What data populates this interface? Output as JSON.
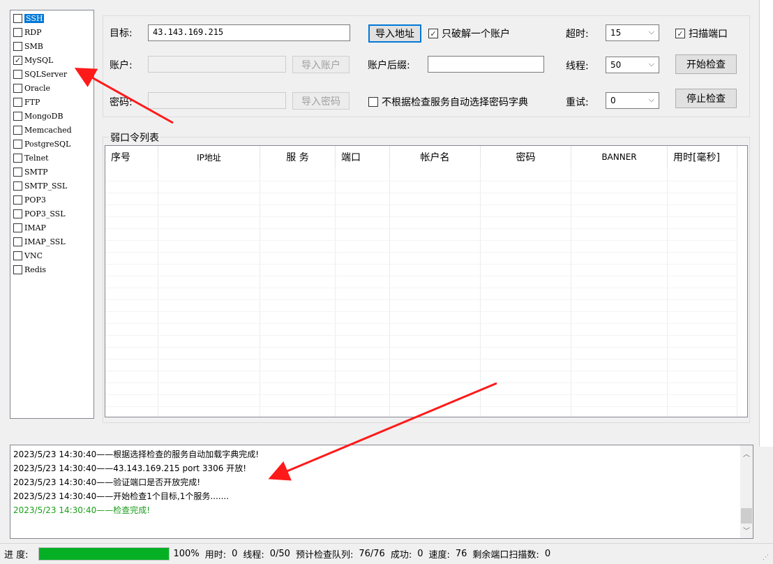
{
  "services": [
    {
      "name": "SSH",
      "checked": false,
      "selected": true
    },
    {
      "name": "RDP",
      "checked": false
    },
    {
      "name": "SMB",
      "checked": false
    },
    {
      "name": "MySQL",
      "checked": true
    },
    {
      "name": "SQLServer",
      "checked": false
    },
    {
      "name": "Oracle",
      "checked": false
    },
    {
      "name": "FTP",
      "checked": false
    },
    {
      "name": "MongoDB",
      "checked": false
    },
    {
      "name": "Memcached",
      "checked": false
    },
    {
      "name": "PostgreSQL",
      "checked": false
    },
    {
      "name": "Telnet",
      "checked": false
    },
    {
      "name": "SMTP",
      "checked": false
    },
    {
      "name": "SMTP_SSL",
      "checked": false
    },
    {
      "name": "POP3",
      "checked": false
    },
    {
      "name": "POP3_SSL",
      "checked": false
    },
    {
      "name": "IMAP",
      "checked": false
    },
    {
      "name": "IMAP_SSL",
      "checked": false
    },
    {
      "name": "VNC",
      "checked": false
    },
    {
      "name": "Redis",
      "checked": false
    }
  ],
  "form": {
    "target_label": "目标:",
    "target_value": "43.143.169.215",
    "import_address": "导入地址",
    "only_one_account": "只破解一个账户",
    "account_label": "账户:",
    "import_account": "导入账户",
    "account_suffix_label": "账户后缀:",
    "password_label": "密码:",
    "import_password": "导入密码",
    "no_auto_dict": "不根据检查服务自动选择密码字典",
    "timeout_label": "超时:",
    "timeout_value": "15",
    "threads_label": "线程:",
    "threads_value": "50",
    "retry_label": "重试:",
    "retry_value": "0",
    "scan_ports": "扫描端口",
    "start_check": "开始检查",
    "stop_check": "停止检查"
  },
  "table": {
    "title": "弱口令列表",
    "columns": [
      "序号",
      "IP地址",
      "服 务",
      "端口",
      "帐户名",
      "密码",
      "BANNER",
      "用时[毫秒]"
    ]
  },
  "log": [
    {
      "text": "2023/5/23 14:30:40——根据选择检查的服务自动加载字典完成!",
      "color": "#000000"
    },
    {
      "text": "2023/5/23 14:30:40——43.143.169.215 port 3306 开放!",
      "color": "#000000"
    },
    {
      "text": "2023/5/23 14:30:40——验证端口是否开放完成!",
      "color": "#000000"
    },
    {
      "text": "2023/5/23 14:30:40——开始检查1个目标,1个服务.......",
      "color": "#000000"
    },
    {
      "text": "2023/5/23 14:30:40——检查完成!",
      "color": "#1a9e1a"
    }
  ],
  "status": {
    "progress_label": "进 度:",
    "progress_percent": 100,
    "progress_text": "100%",
    "time_label": "用时:",
    "time_value": "0",
    "threads_label": "线程:",
    "threads_value": "0/50",
    "queue_label": "预计检查队列:",
    "queue_value": "76/76",
    "success_label": "成功:",
    "success_value": "0",
    "speed_label": "速度:",
    "speed_value": "76",
    "remaining_label": "剩余端口扫描数:",
    "remaining_value": "0"
  },
  "colors": {
    "accent": "#0078d7",
    "progress": "#06b025",
    "annotation": "#ff1a1a"
  }
}
